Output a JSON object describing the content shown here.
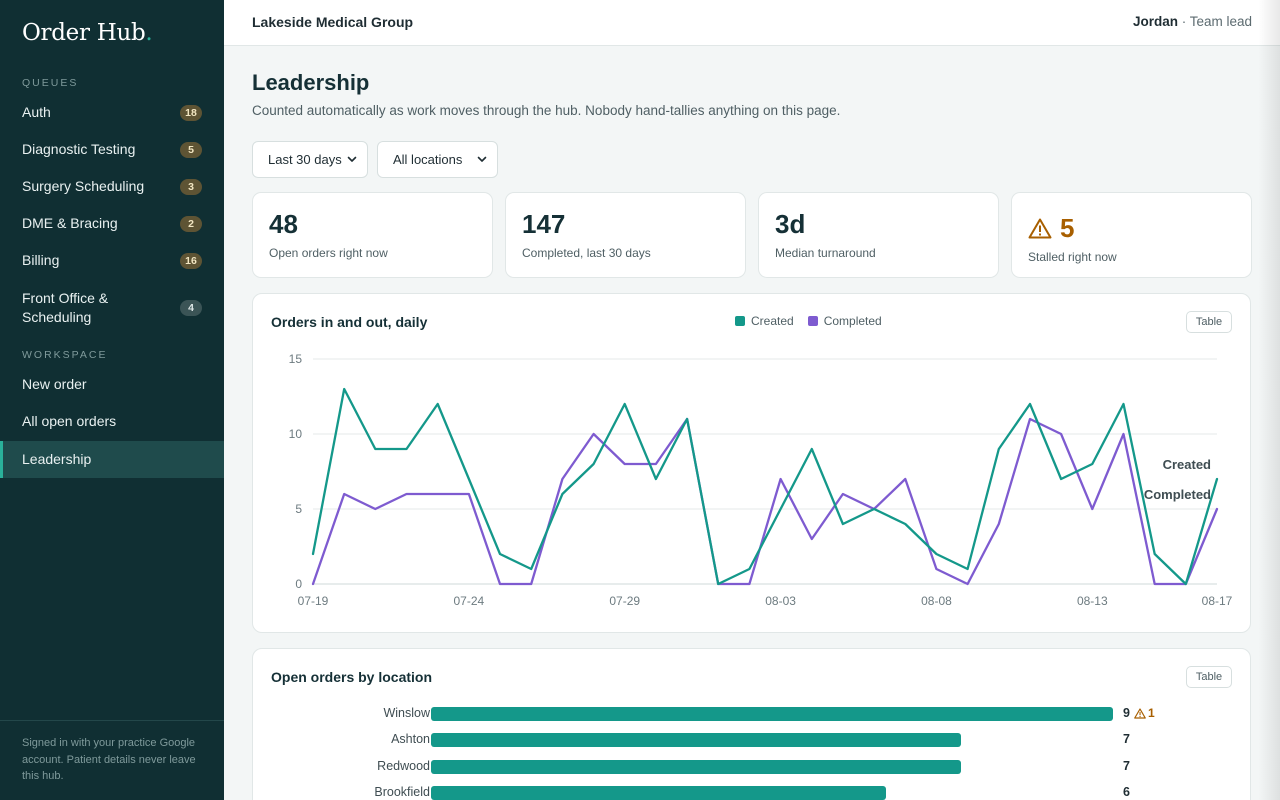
{
  "brand": {
    "name": "Order Hub",
    "dot": "."
  },
  "sidebar": {
    "queues_label": "QUEUES",
    "queues": [
      {
        "label": "Auth",
        "count": "18"
      },
      {
        "label": "Diagnostic Testing",
        "count": "5"
      },
      {
        "label": "Surgery Scheduling",
        "count": "3"
      },
      {
        "label": "DME & Bracing",
        "count": "2"
      },
      {
        "label": "Billing",
        "count": "16"
      },
      {
        "label": "Front Office & Scheduling",
        "count": "4"
      }
    ],
    "workspace_label": "WORKSPACE",
    "workspace": [
      {
        "label": "New order"
      },
      {
        "label": "All open orders"
      },
      {
        "label": "Leadership",
        "active": true
      }
    ],
    "footer": "Signed in with your practice Google account. Patient details never leave this hub."
  },
  "topbar": {
    "org": "Lakeside Medical Group",
    "user_name": "Jordan",
    "user_role": " · Team lead"
  },
  "page": {
    "title": "Leadership",
    "description": "Counted automatically as work moves through the hub. Nobody hand-tallies anything on this page."
  },
  "filters": {
    "range": "Last 30 days",
    "location": "All locations"
  },
  "kpis": [
    {
      "value": "48",
      "label": "Open orders right now"
    },
    {
      "value": "147",
      "label": "Completed, last 30 days"
    },
    {
      "value": "3d",
      "label": "Median turnaround"
    },
    {
      "value": "5",
      "label": "Stalled right now",
      "icon": "warning-icon"
    }
  ],
  "line_card": {
    "title": "Orders in and out, daily",
    "table_label": "Table",
    "end_labels": [
      "Created",
      "Completed"
    ]
  },
  "bar_card": {
    "title": "Open orders by location",
    "table_label": "Table"
  },
  "colors": {
    "created": "#14988a",
    "completed": "#7e5bd0",
    "bar": "#14988a",
    "warning": "#a85f00",
    "sidebar": "#102f33"
  },
  "chart_data": [
    {
      "type": "line",
      "title": "Orders in and out, daily",
      "x": [
        "07-19",
        "07-20",
        "07-21",
        "07-22",
        "07-23",
        "07-24",
        "07-25",
        "07-26",
        "07-27",
        "07-28",
        "07-29",
        "07-30",
        "07-31",
        "08-01",
        "08-02",
        "08-03",
        "08-04",
        "08-05",
        "08-06",
        "08-07",
        "08-08",
        "08-09",
        "08-10",
        "08-11",
        "08-12",
        "08-13",
        "08-14",
        "08-15",
        "08-16",
        "08-17"
      ],
      "x_ticks": [
        "07-19",
        "07-24",
        "07-29",
        "08-03",
        "08-08",
        "08-13",
        "08-17"
      ],
      "ylim": [
        0,
        15
      ],
      "y_ticks": [
        0,
        5,
        10,
        15
      ],
      "grid": true,
      "legend": "top-center",
      "series": [
        {
          "name": "Created",
          "values": [
            2,
            13,
            9,
            9,
            12,
            7,
            2,
            1,
            6,
            8,
            12,
            7,
            11,
            0,
            1,
            5,
            9,
            4,
            5,
            4,
            2,
            1,
            9,
            12,
            7,
            8,
            12,
            2,
            0,
            7
          ]
        },
        {
          "name": "Completed",
          "values": [
            0,
            6,
            5,
            6,
            6,
            6,
            0,
            0,
            7,
            10,
            8,
            8,
            11,
            0,
            0,
            7,
            3,
            6,
            5,
            7,
            1,
            0,
            4,
            11,
            10,
            5,
            10,
            0,
            0,
            5
          ]
        }
      ]
    },
    {
      "type": "bar",
      "title": "Open orders by location",
      "categories": [
        "Winslow",
        "Ashton",
        "Redwood",
        "Brookfield"
      ],
      "values": [
        9,
        7,
        7,
        6
      ],
      "stalled": [
        1,
        0,
        0,
        0
      ],
      "max": 9
    }
  ]
}
